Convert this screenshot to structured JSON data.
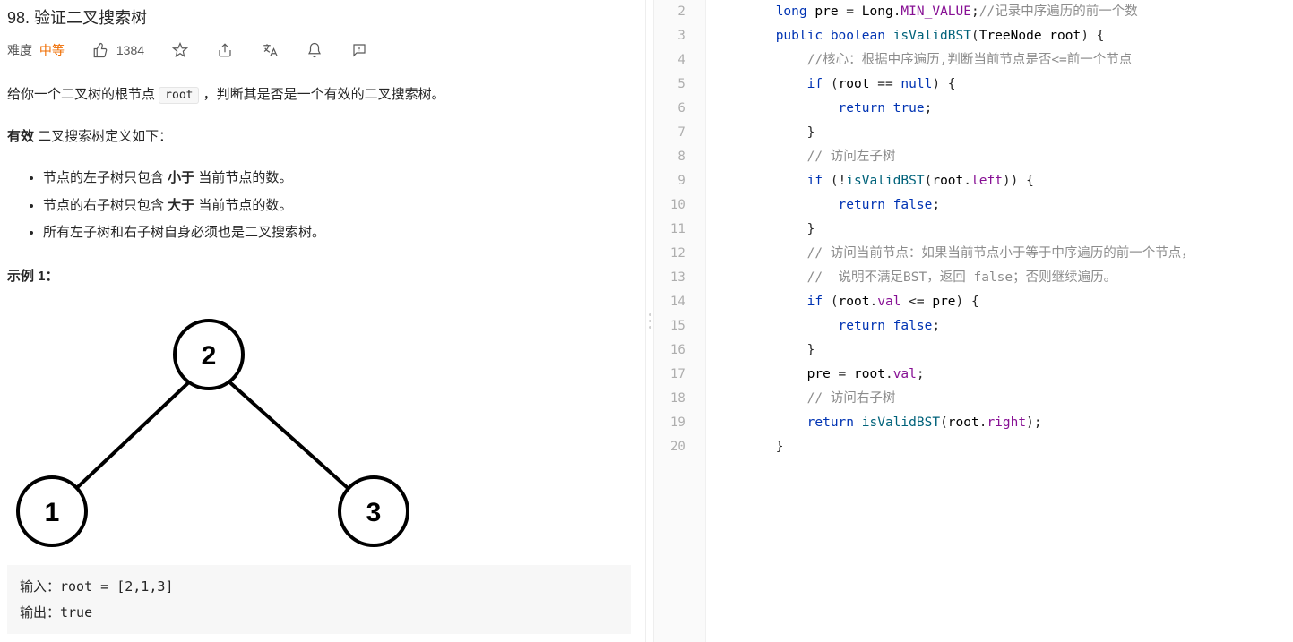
{
  "problem": {
    "title": "98. 验证二叉搜索树",
    "difficulty_label": "难度",
    "difficulty_value": "中等",
    "likes": "1384",
    "intro_pre": "给你一个二叉树的根节点 ",
    "intro_code": "root",
    "intro_post": " ，判断其是否是一个有效的二叉搜索树。",
    "valid_label": "有效",
    "valid_suffix": " 二叉搜索树定义如下：",
    "rules": {
      "r1_pre": "节点的左子树只包含 ",
      "r1_bold": "小于",
      "r1_post": " 当前节点的数。",
      "r2_pre": "节点的右子树只包含 ",
      "r2_bold": "大于",
      "r2_post": " 当前节点的数。",
      "r3": "所有左子树和右子树自身必须也是二叉搜索树。"
    },
    "example_label": "示例 1：",
    "tree_nodes": {
      "root": "2",
      "left": "1",
      "right": "3"
    },
    "example_input": "输入：root = [2,1,3]",
    "example_output": "输出：true"
  },
  "code": {
    "line_numbers": [
      "2",
      "3",
      "4",
      "5",
      "6",
      "7",
      "8",
      "9",
      "10",
      "11",
      "12",
      "13",
      "14",
      "15",
      "16",
      "17",
      "18",
      "19",
      "20"
    ],
    "lines": {
      "l2": {
        "kw1": "long",
        "var": "pre",
        "eq": " = ",
        "kw2": "Long",
        "dot": ".",
        "field": "MIN_VALUE",
        "sc": ";",
        "cmt": "//记录中序遍历的前一个数"
      },
      "l3": {
        "kw1": "public",
        "kw2": "boolean",
        "fn": "isValidBST",
        "p1": "(",
        "type": "TreeNode",
        "arg": "root",
        "p2": ") {"
      },
      "l4": "//核心：根据中序遍历,判断当前节点是否<=前一个节点",
      "l5": {
        "kw": "if",
        "open": " (",
        "var": "root",
        "op": " == ",
        "kw2": "null",
        "close": ") {"
      },
      "l6": {
        "kw": "return",
        "val": "true",
        "sc": ";"
      },
      "l7": "}",
      "l8": "// 访问左子树",
      "l9": {
        "kw": "if",
        "open": " (!",
        "fn": "isValidBST",
        "p1": "(",
        "var": "root",
        "dot": ".",
        "field": "left",
        "p2": ")) {"
      },
      "l10": {
        "kw": "return",
        "val": "false",
        "sc": ";"
      },
      "l11": "}",
      "l12": "// 访问当前节点：如果当前节点小于等于中序遍历的前一个节点，",
      "l13": "//  说明不满足BST，返回 false；否则继续遍历。",
      "l14": {
        "kw": "if",
        "open": " (",
        "var": "root",
        "dot": ".",
        "field": "val",
        "op": " <= ",
        "var2": "pre",
        "close": ") {"
      },
      "l15": {
        "kw": "return",
        "val": "false",
        "sc": ";"
      },
      "l16": "}",
      "l17": {
        "var": "pre",
        "eq": " = ",
        "var2": "root",
        "dot": ".",
        "field": "val",
        "sc": ";"
      },
      "l18": "// 访问右子树",
      "l19": {
        "kw": "return",
        "sp": " ",
        "fn": "isValidBST",
        "p1": "(",
        "var": "root",
        "dot": ".",
        "field": "right",
        "p2": ");"
      },
      "l20": "}"
    }
  }
}
